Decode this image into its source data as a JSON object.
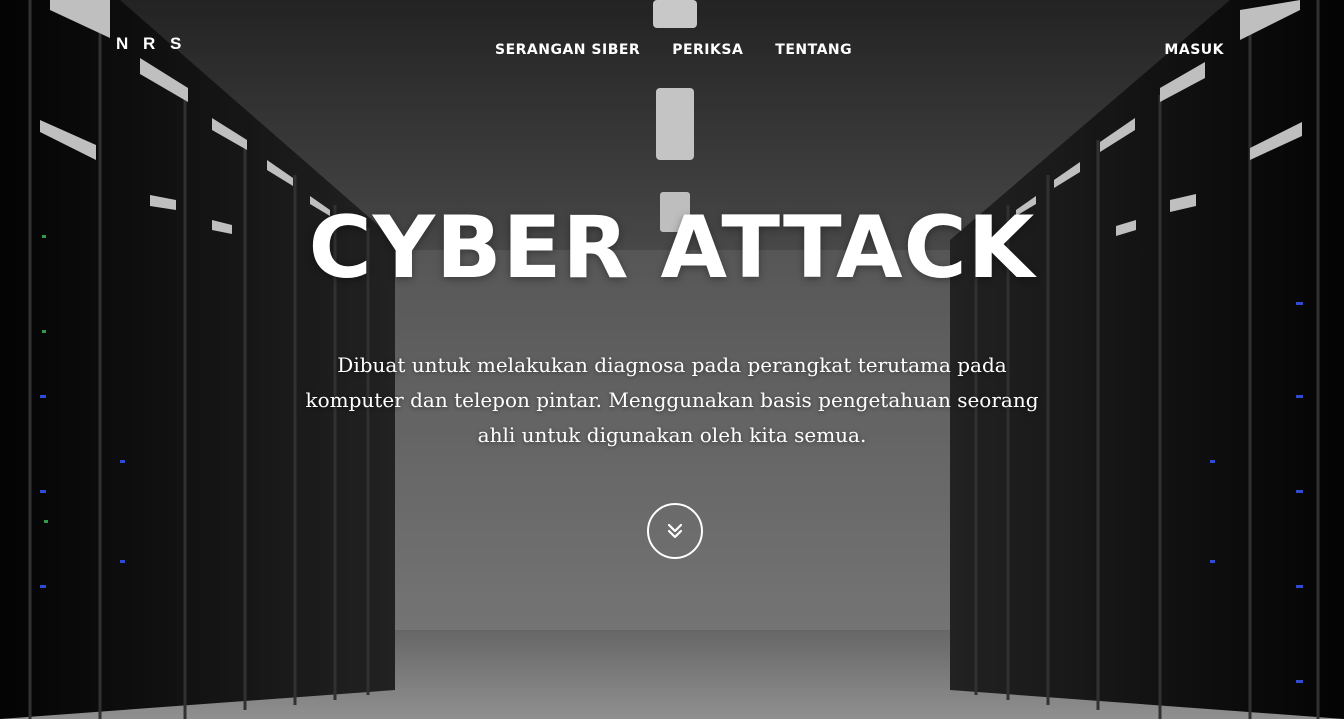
{
  "nav": {
    "logo": "N R S",
    "menu": [
      "SERANGAN SIBER",
      "PERIKSA",
      "TENTANG"
    ],
    "login": "MASUK"
  },
  "hero": {
    "title": "CYBER ATTACK",
    "description": "Dibuat untuk melakukan diagnosa pada perangkat terutama pada komputer dan telepon pintar. Menggunakan basis pengetahuan seorang ahli untuk digunakan oleh kita semua.",
    "scroll_icon": "double-chevron-down-icon",
    "background": "server-room-corridor"
  },
  "colors": {
    "text": "#ffffff",
    "rack": "#0f0f0f",
    "led_blue": "#3b5bff",
    "led_green": "#3dbb5a"
  }
}
